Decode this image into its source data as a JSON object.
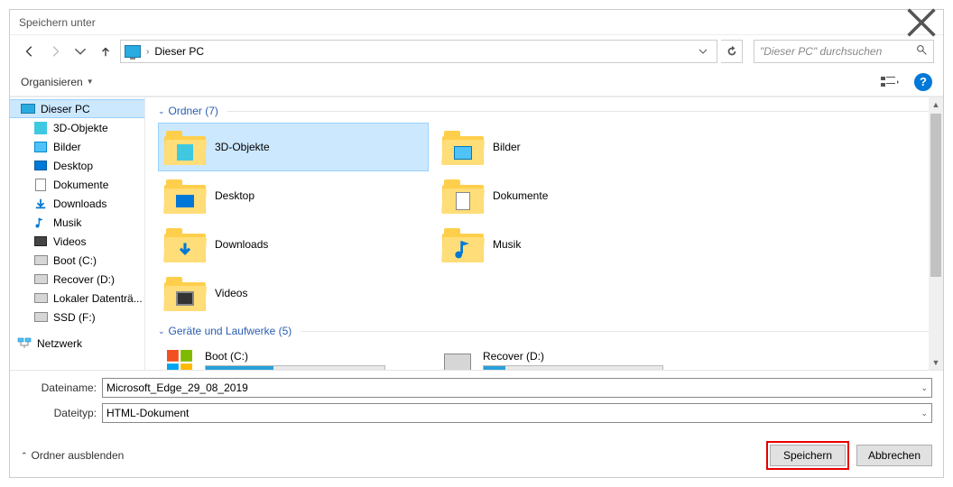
{
  "title": "Speichern unter",
  "location": "Dieser PC",
  "search_placeholder": "\"Dieser PC\" durchsuchen",
  "toolbar": {
    "organize": "Organisieren"
  },
  "sidebar": {
    "root": "Dieser PC",
    "items": [
      "3D-Objekte",
      "Bilder",
      "Desktop",
      "Dokumente",
      "Downloads",
      "Musik",
      "Videos",
      "Boot (C:)",
      "Recover (D:)",
      "Lokaler Datenträ...",
      "SSD (F:)"
    ],
    "network": "Netzwerk"
  },
  "groups": {
    "folders_label": "Ordner (7)",
    "drives_label": "Geräte und Laufwerke (5)"
  },
  "folders": [
    "3D-Objekte",
    "Bilder",
    "Desktop",
    "Dokumente",
    "Downloads",
    "Musik",
    "Videos"
  ],
  "drives": [
    "Boot (C:)",
    "Recover (D:)"
  ],
  "form": {
    "filename_label": "Dateiname:",
    "filename_value": "Microsoft_Edge_29_08_2019",
    "filetype_label": "Dateityp:",
    "filetype_value": "HTML-Dokument"
  },
  "footer": {
    "hide_folders": "Ordner ausblenden",
    "save": "Speichern",
    "cancel": "Abbrechen"
  }
}
